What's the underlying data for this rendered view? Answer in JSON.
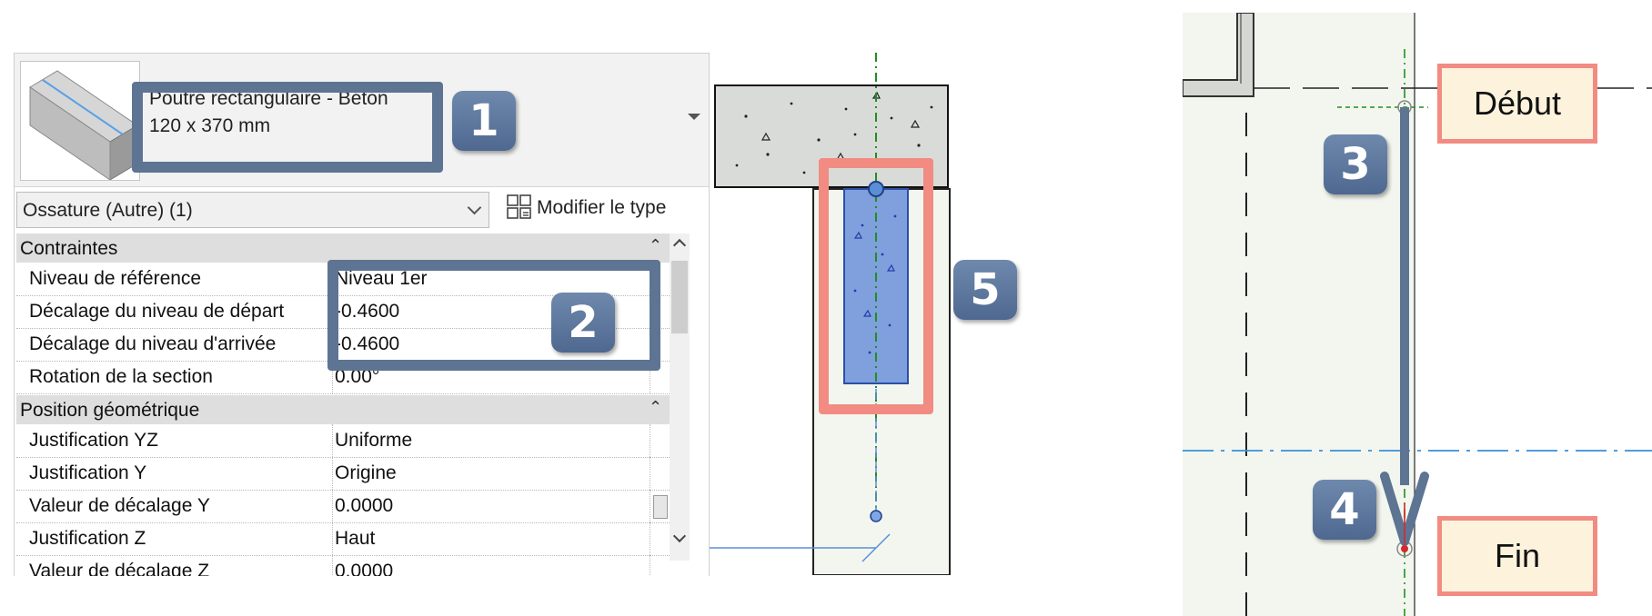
{
  "type_selector": {
    "name_line1": "Poutre rectangulaire - Béton",
    "name_line2": "120 x 370 mm"
  },
  "category_filter": {
    "value": "Ossature (Autre) (1)"
  },
  "edit_type": {
    "label": "Modifier le type"
  },
  "sections": [
    {
      "title": "Contraintes"
    },
    {
      "title": "Position géométrique"
    }
  ],
  "rows": [
    {
      "label": "Niveau de référence",
      "value": "Niveau 1er"
    },
    {
      "label": "Décalage du niveau de départ",
      "value": "-0.4600"
    },
    {
      "label": "Décalage du niveau d'arrivée",
      "value": "-0.4600"
    },
    {
      "label": "Rotation de la section",
      "value": "0.00°"
    },
    {
      "label": "Justification YZ",
      "value": "Uniforme"
    },
    {
      "label": "Justification Y",
      "value": "Origine"
    },
    {
      "label": "Valeur de décalage Y",
      "value": "0.0000"
    },
    {
      "label": "Justification Z",
      "value": "Haut"
    },
    {
      "label": "Valeur de décalage Z",
      "value": "0.0000"
    }
  ],
  "badges": [
    "1",
    "2",
    "3",
    "4",
    "5"
  ],
  "flags": {
    "start": "Début",
    "end": "Fin"
  },
  "colors": {
    "callout_blue": "#5d7493",
    "callout_pink": "#f28b82",
    "beam_fill": "#7f9fdd",
    "flag_fill": "#fdf3dd",
    "section_green": "#1e8f1e",
    "grid_blue": "#3a8fd6"
  }
}
